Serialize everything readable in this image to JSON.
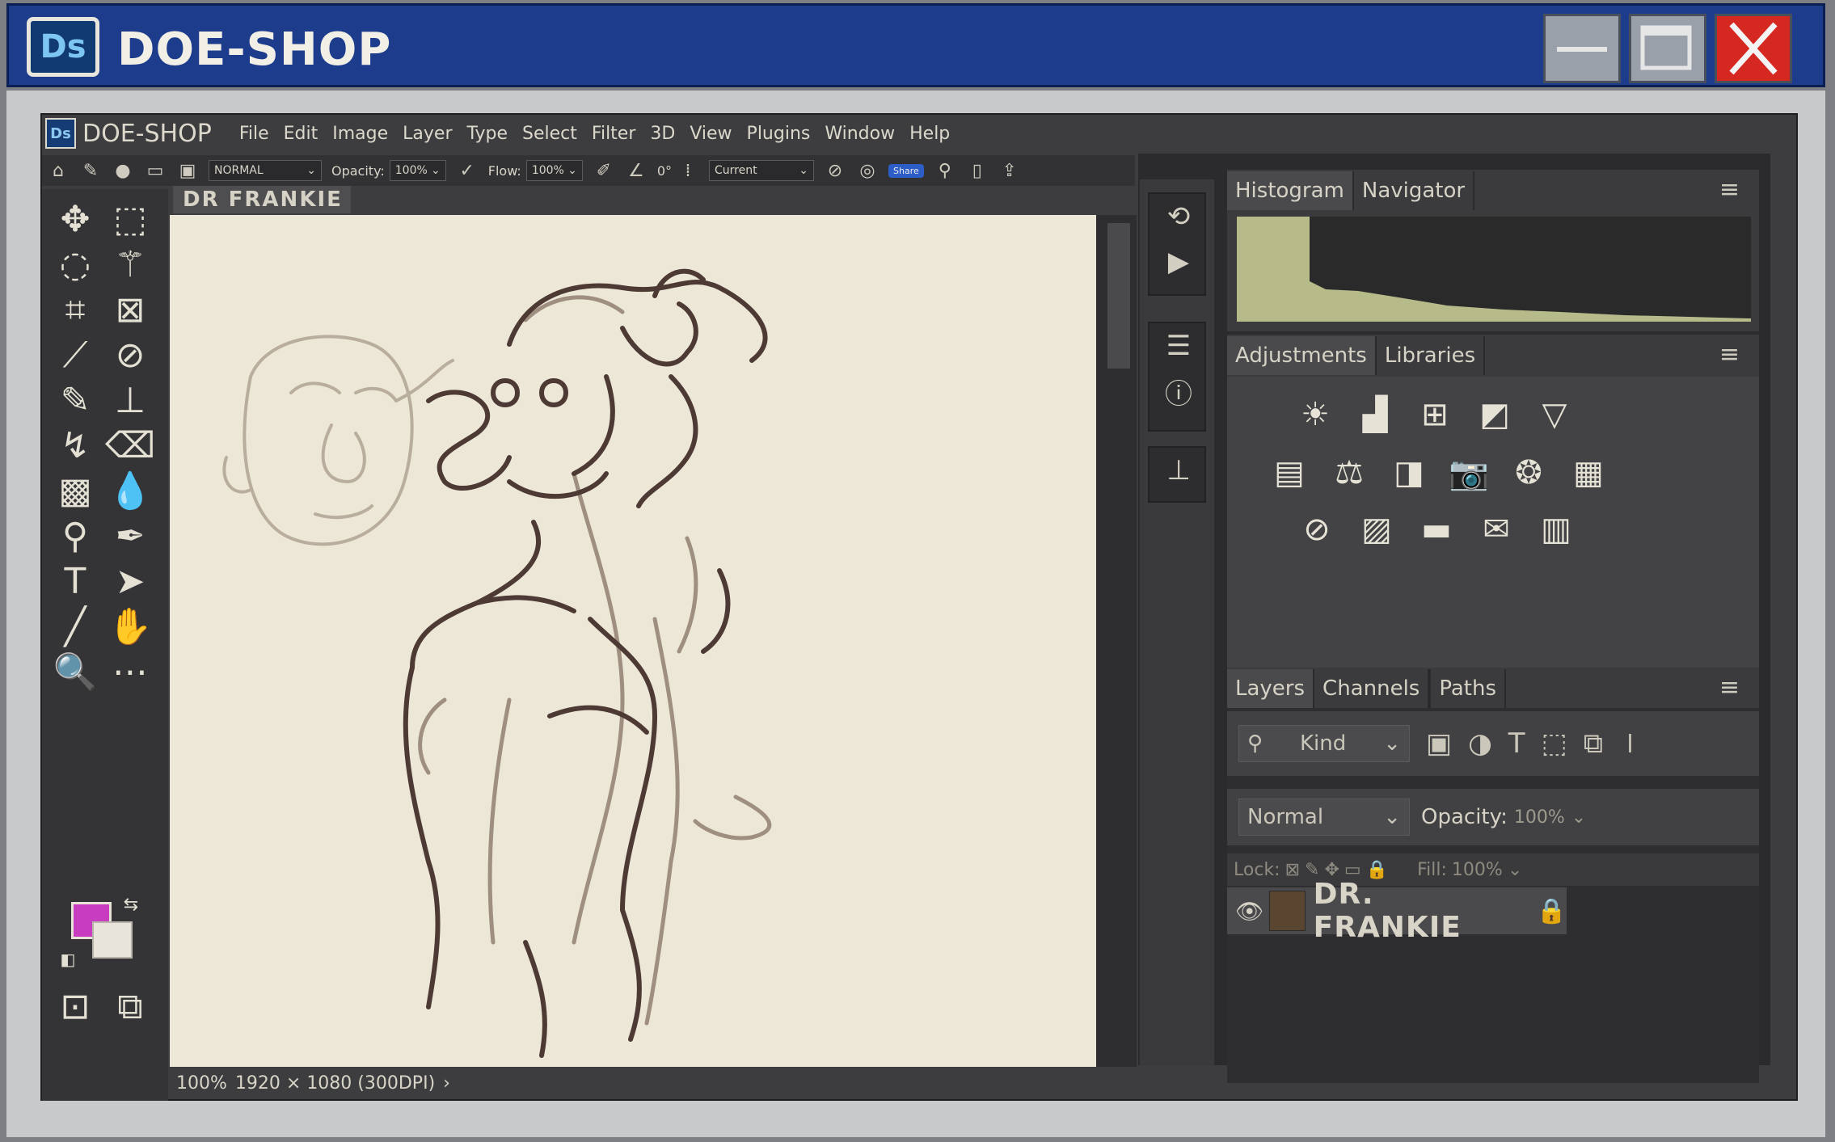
{
  "window": {
    "logo": "Ds",
    "title": "DOE-SHOP"
  },
  "app": {
    "logo": "Ds",
    "name": "DOE-SHOP",
    "menu": [
      "File",
      "Edit",
      "Image",
      "Layer",
      "Type",
      "Select",
      "Filter",
      "3D",
      "View",
      "Plugins",
      "Window",
      "Help"
    ]
  },
  "options": {
    "mode": "NORMAL",
    "opacity_label": "Opacity:",
    "opacity_value": "100%",
    "flow_label": "Flow:",
    "flow_value": "100%",
    "angle": "0°",
    "sample": "Current",
    "share": "Share"
  },
  "document": {
    "tab": "DR FRANKIE",
    "zoom": "100%",
    "size": "1920 × 1080 (300DPI)"
  },
  "histogram_panel": {
    "tabs": [
      "Histogram",
      "Navigator"
    ]
  },
  "adjustments_panel": {
    "tabs": [
      "Adjustments",
      "Libraries"
    ]
  },
  "layers_panel": {
    "tabs": [
      "Layers",
      "Channels",
      "Paths"
    ],
    "kind": "Kind",
    "blend": "Normal",
    "opacity_label": "Opacity:",
    "opacity_value": "100%",
    "lock_label": "Lock:",
    "fill_label": "Fill:",
    "fill_value": "100%",
    "layer_name": "DR. FRANKIE"
  },
  "colors": {
    "foreground": "#c83cc0",
    "background": "#e8e4dc",
    "titlebar": "#1d3d8c",
    "close": "#d52820",
    "canvas": "#ece7d6"
  }
}
